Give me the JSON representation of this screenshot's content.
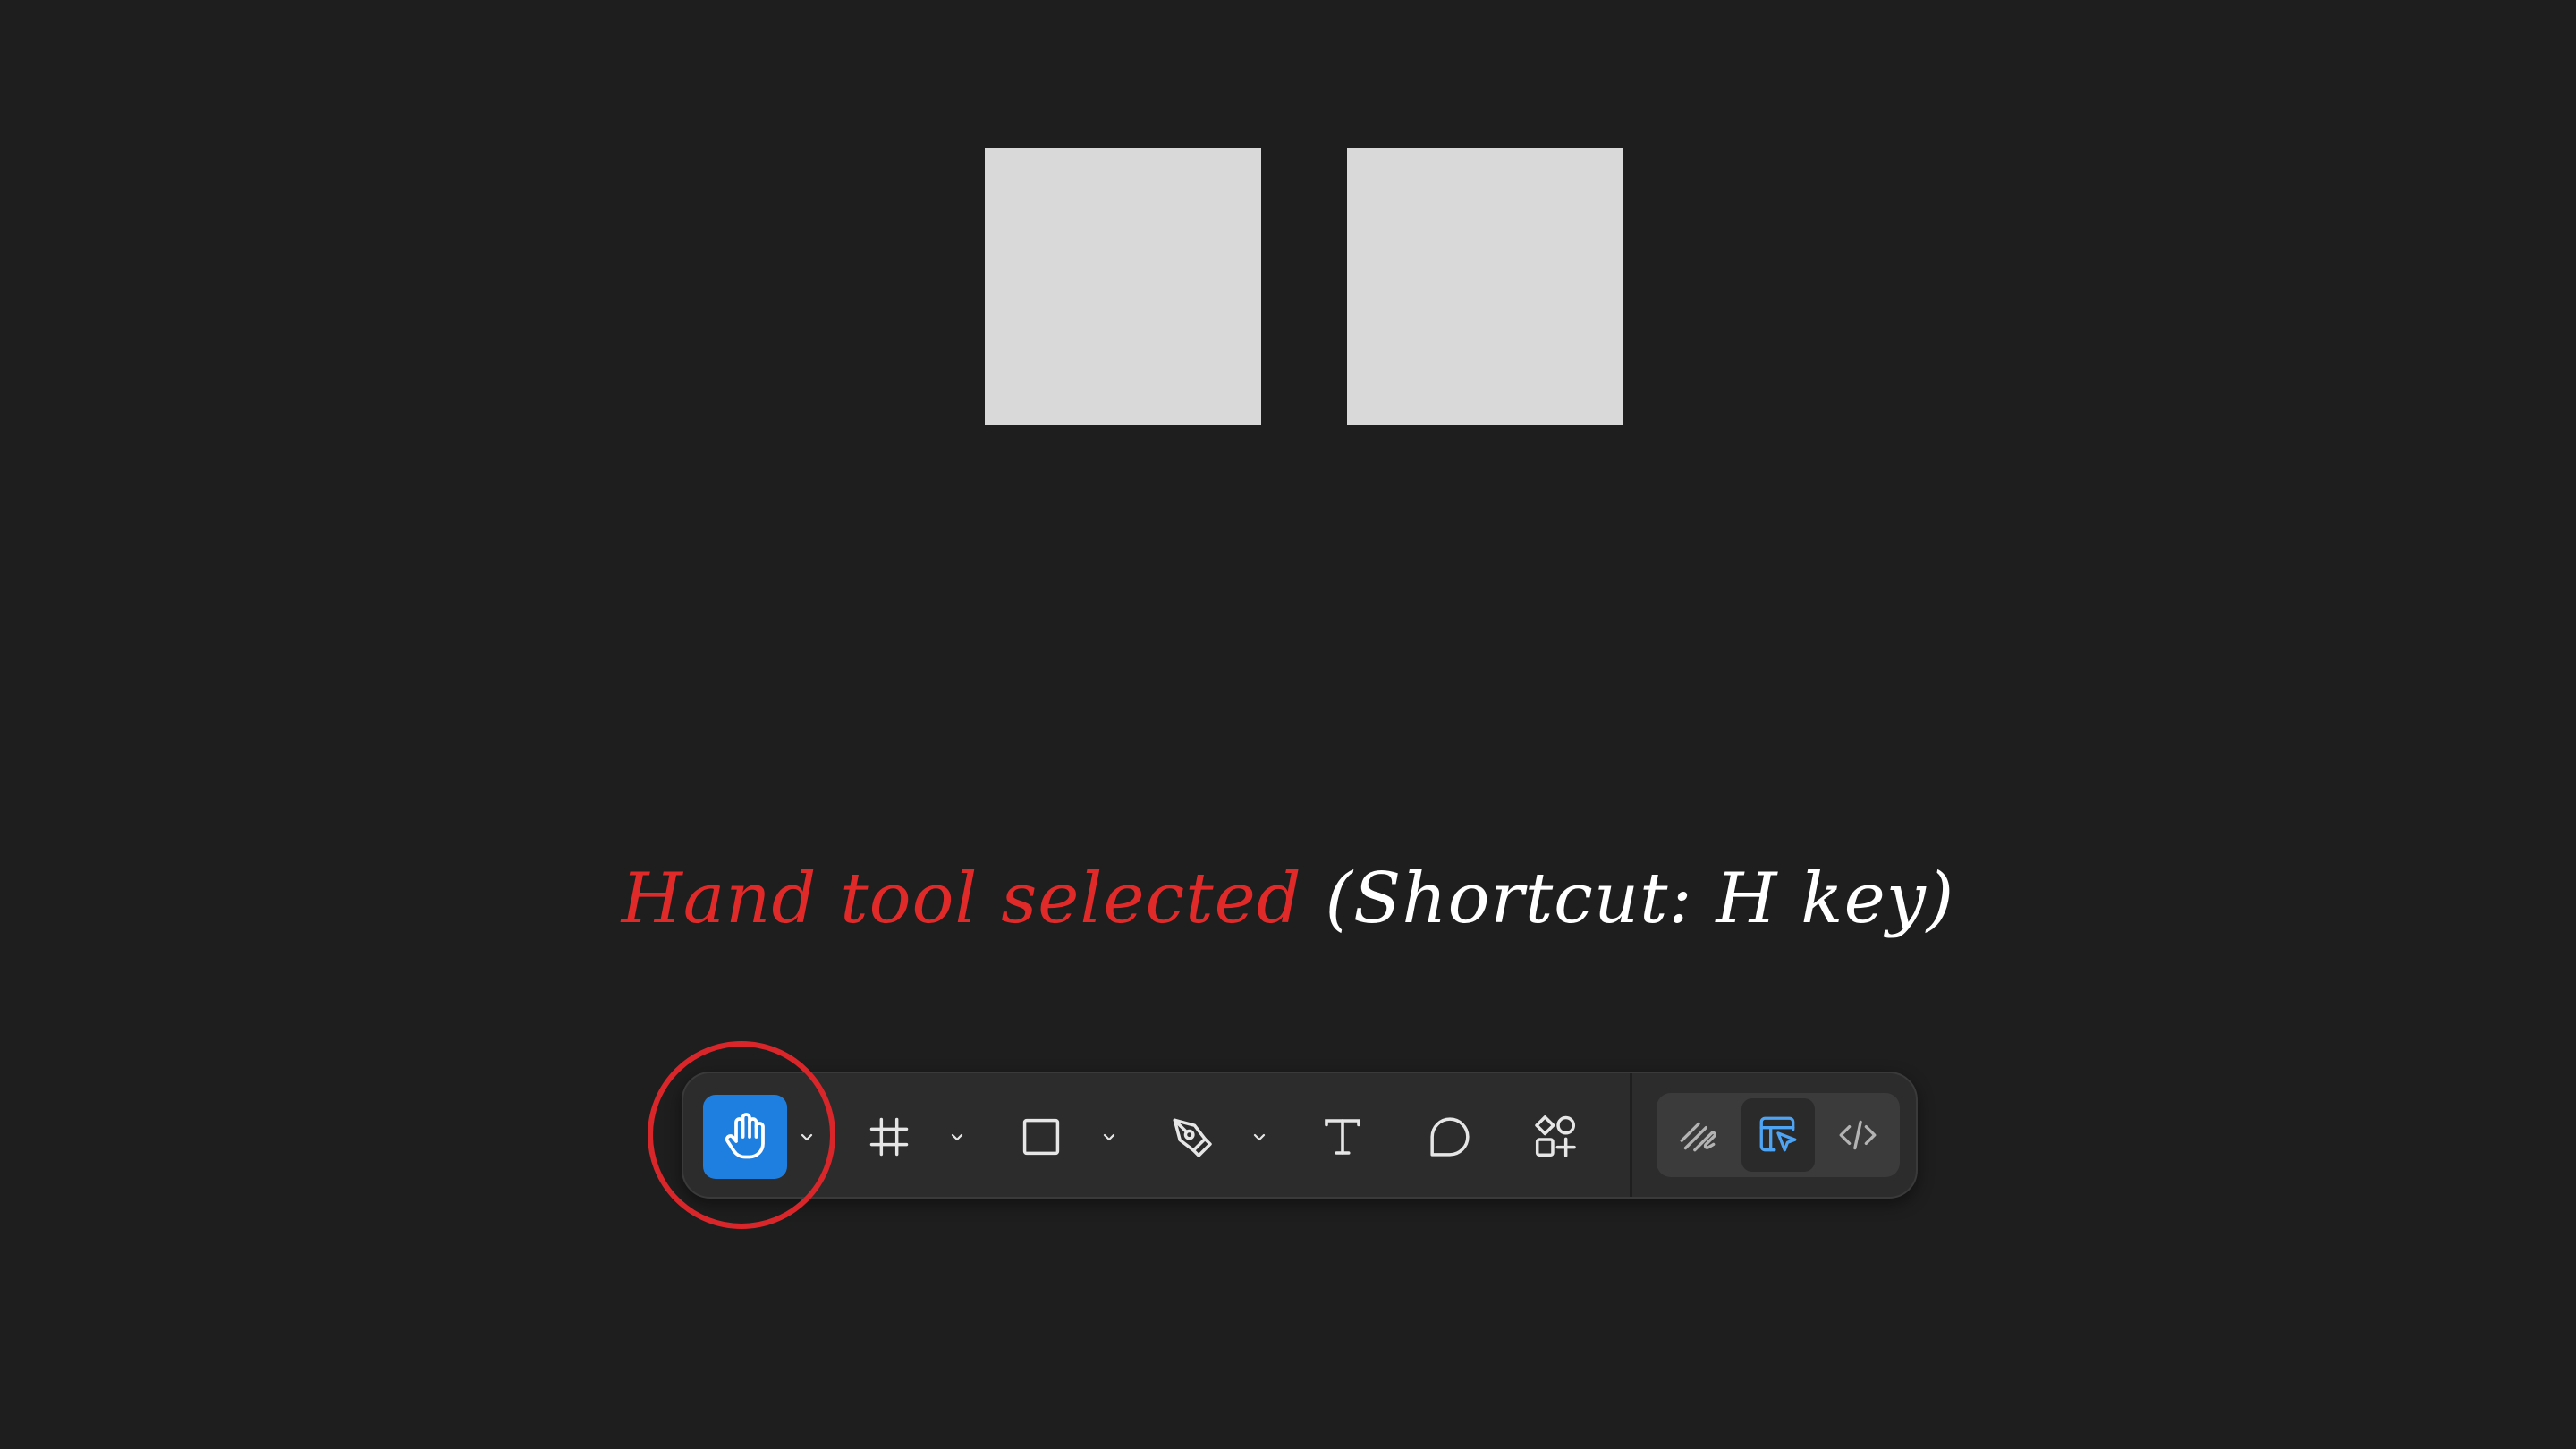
{
  "canvas": {
    "background": "#1e1e1e",
    "frames": [
      {
        "name": "frame-left",
        "fill": "#d9d9d9"
      },
      {
        "name": "frame-right",
        "fill": "#d9d9d9"
      }
    ]
  },
  "annotation": {
    "highlight_text": "Hand tool selected",
    "rest_text": " (Shortcut: H key)",
    "highlight_color": "#e02a2a",
    "rest_color": "#ffffff"
  },
  "toolbar": {
    "tools": [
      {
        "name": "hand-tool",
        "icon": "hand-icon",
        "selected": true,
        "has_dropdown": true
      },
      {
        "name": "frame-tool",
        "icon": "hash-frame-icon",
        "selected": false,
        "has_dropdown": true
      },
      {
        "name": "shape-tool",
        "icon": "rectangle-icon",
        "selected": false,
        "has_dropdown": true
      },
      {
        "name": "pen-tool",
        "icon": "pen-icon",
        "selected": false,
        "has_dropdown": true
      },
      {
        "name": "text-tool",
        "icon": "text-icon",
        "selected": false,
        "has_dropdown": false
      },
      {
        "name": "comment-tool",
        "icon": "comment-bubble-icon",
        "selected": false,
        "has_dropdown": false
      },
      {
        "name": "assets-tool",
        "icon": "shapes-plus-icon",
        "selected": false,
        "has_dropdown": false
      }
    ],
    "modes": [
      {
        "name": "draw-mode",
        "icon": "scribble-icon",
        "active": false
      },
      {
        "name": "design-mode",
        "icon": "design-layout-icon",
        "active": true
      },
      {
        "name": "dev-mode",
        "icon": "code-icon",
        "active": false
      }
    ],
    "accent_color": "#1e7fe0",
    "highlight_ring_color": "#d9262a"
  }
}
